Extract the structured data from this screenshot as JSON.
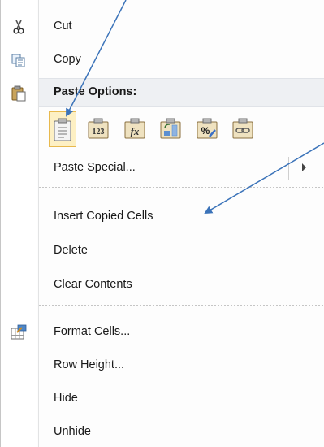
{
  "menu": {
    "items": [
      {
        "label": "Cut",
        "icon": "scissors-icon"
      },
      {
        "label": "Copy",
        "icon": "copy-icon"
      },
      {
        "label": "Paste Special...",
        "icon": ""
      },
      {
        "label": "Insert Copied Cells",
        "icon": ""
      },
      {
        "label": "Delete",
        "icon": ""
      },
      {
        "label": "Clear Contents",
        "icon": ""
      },
      {
        "label": "Format Cells...",
        "icon": "format-cells-icon"
      },
      {
        "label": "Row Height...",
        "icon": ""
      },
      {
        "label": "Hide",
        "icon": ""
      },
      {
        "label": "Unhide",
        "icon": ""
      }
    ],
    "paste_options": {
      "header": "Paste Options:",
      "header_icon": "clipboard-icon",
      "buttons": [
        {
          "name": "paste-icon",
          "text": ""
        },
        {
          "name": "paste-values-icon",
          "text": "123"
        },
        {
          "name": "paste-formulas-icon",
          "text": "fx"
        },
        {
          "name": "paste-transpose-icon",
          "text": ""
        },
        {
          "name": "paste-formatting-icon",
          "text": "%"
        },
        {
          "name": "paste-link-icon",
          "text": ""
        }
      ],
      "selected_index": 0
    }
  },
  "colors": {
    "arrow": "#3b73b9",
    "selected_fill": "#fdf0c4",
    "selected_border": "#e8b94d",
    "header_bg": "#eef0f3"
  }
}
